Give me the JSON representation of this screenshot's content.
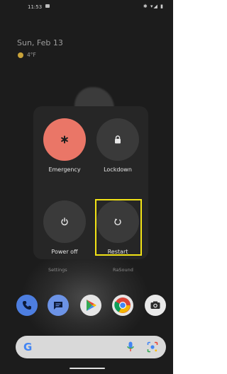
{
  "status_bar": {
    "time": "11:53",
    "icons": "✱ ▾◢ ▮"
  },
  "lockscreen": {
    "date": "Sun, Feb 13",
    "temperature": "4°F"
  },
  "power_menu": {
    "emergency_label": "Emergency",
    "lockdown_label": "Lockdown",
    "power_off_label": "Power off",
    "restart_label": "Restart"
  },
  "apps": {
    "settings_label": "Settings",
    "rasound_label": "RaSound"
  },
  "search": {
    "g_logo": "G"
  },
  "colors": {
    "emergency": "#ea7667",
    "highlight": "#f2e316",
    "phone": "#4d7ee0",
    "messages": "#6c93e6",
    "play_green": "#34a853",
    "play_yellow": "#fbbc05",
    "play_red": "#ea4335",
    "play_blue": "#4285f4",
    "chrome_red": "#db4437",
    "chrome_yellow": "#f4b400",
    "chrome_green": "#0f9d58",
    "chrome_center": "#4285f4"
  }
}
